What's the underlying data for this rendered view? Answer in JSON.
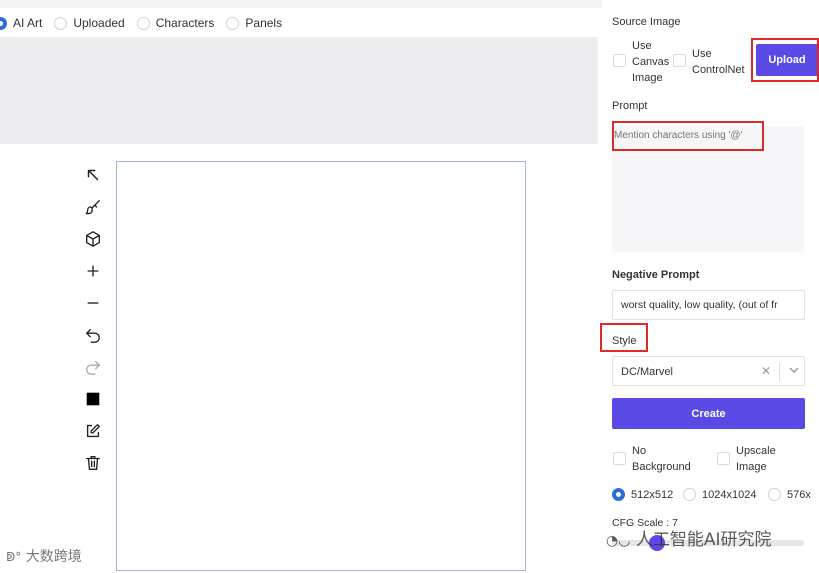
{
  "tabs": [
    {
      "label": "AI Art",
      "selected": true
    },
    {
      "label": "Uploaded",
      "selected": false
    },
    {
      "label": "Characters",
      "selected": false
    },
    {
      "label": "Panels",
      "selected": false
    }
  ],
  "tools": [
    "arrow-up-left-icon",
    "brush-icon",
    "cube-icon",
    "plus-icon",
    "minus-icon",
    "undo-icon",
    "redo-icon",
    "color-square-icon",
    "edit-icon",
    "trash-icon"
  ],
  "panel": {
    "source_image_label": "Source Image",
    "use_canvas_label": "Use\nCanvas\nImage",
    "use_controlnet_label": "Use\nControlNet",
    "upload_label": "Upload",
    "prompt_label": "Prompt",
    "prompt_placeholder": "Mention characters using '@'",
    "negative_prompt_label": "Negative Prompt",
    "negative_prompt_value": "worst quality, low quality, (out of fr",
    "style_label": "Style",
    "style_value": "DC/Marvel",
    "create_label": "Create",
    "no_background_label": "No\nBackground",
    "upscale_label": "Upscale\nImage",
    "resolutions": [
      {
        "label": "512x512",
        "selected": true
      },
      {
        "label": "1024x1024",
        "selected": false
      },
      {
        "label": "576x",
        "selected": false
      }
    ],
    "cfg_label": "CFG Scale : 7",
    "cfg_value": 7
  },
  "watermarks": {
    "left": "大数跨境",
    "right": "人工智能AI研究院"
  },
  "colors": {
    "accent": "#5b49e5",
    "highlight": "#e02a2a",
    "radio": "#2b6fd6"
  }
}
